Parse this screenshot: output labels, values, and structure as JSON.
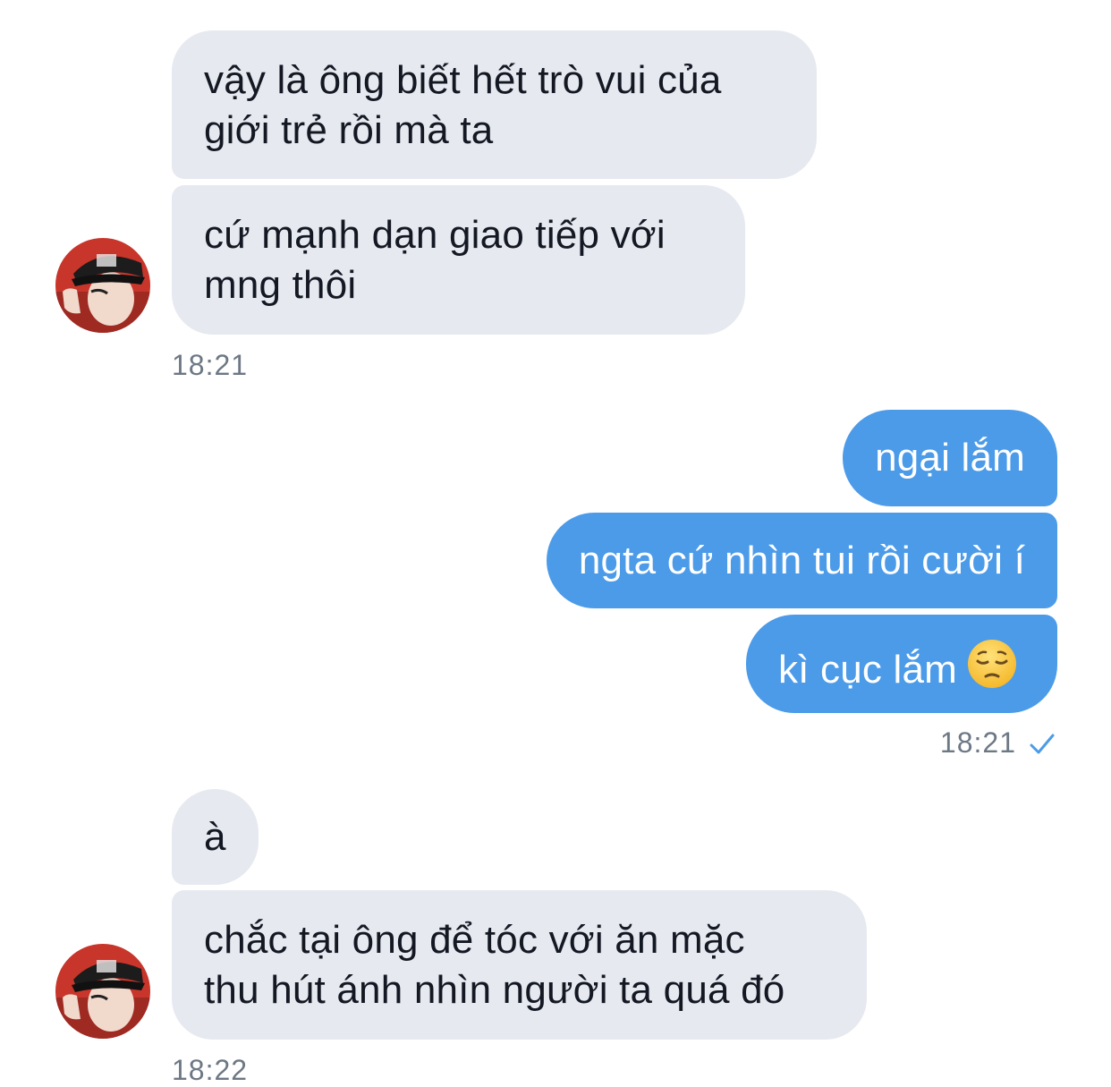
{
  "conversation": {
    "received_1": {
      "messages": [
        "vậy là ông biết hết trò vui của\ngiới trẻ rồi mà ta",
        "cứ mạnh dạn giao tiếp với\nmng thôi"
      ],
      "time": "18:21"
    },
    "sent_1": {
      "messages": [
        "ngại lắm",
        "ngta cứ nhìn tui rồi cười í",
        "kì cục lắm"
      ],
      "emoji": "pensive-face",
      "time": "18:21",
      "status_icon": "check-icon"
    },
    "received_2": {
      "messages": [
        "à",
        "chắc tại ông để tóc với ăn mặc\nthu hút ánh nhìn người ta quá đó"
      ],
      "time": "18:22"
    }
  },
  "colors": {
    "received_bubble": "#e6e9ef",
    "sent_bubble": "#4c9be9",
    "timestamp": "#6d7885",
    "check": "#4c9be9"
  }
}
